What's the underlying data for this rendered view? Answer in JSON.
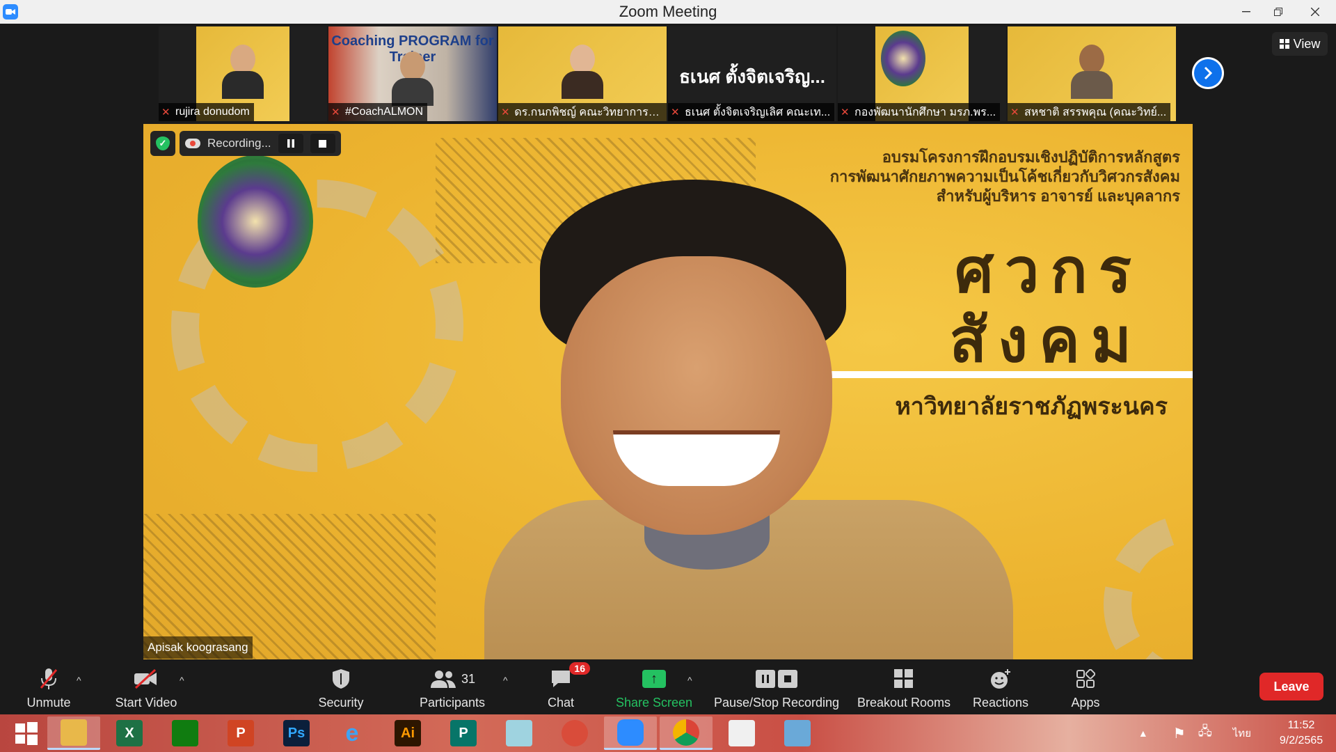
{
  "window": {
    "title": "Zoom Meeting"
  },
  "strip": {
    "tiles": [
      {
        "name": "rujira donudom",
        "muted": true
      },
      {
        "name": "#CoachALMON",
        "muted": true,
        "banner_text": "Coaching PROGRAM for Trainer"
      },
      {
        "name": "ดร.กนกพิชญ์ คณะวิทยาการจัด...",
        "muted": true
      },
      {
        "name": "ธเนศ ตั้งจิตเจริญเลิศ คณะเท...",
        "muted": true,
        "big_name": "ธเนศ ตั้งจิตเจริญ..."
      },
      {
        "name": "กองพัฒนานักศึกษา มรภ.พร...",
        "muted": true
      },
      {
        "name": "สหชาติ สรรพคุณ (คณะวิทย์...",
        "muted": true
      }
    ],
    "view_label": "View"
  },
  "main": {
    "speaker_name": "Apisak koograsang",
    "recording_label": "Recording...",
    "banner": {
      "line1": "อบรมโครงการฝึกอบรมเชิงปฏิบัติการหลักสูตร",
      "line2": "การพัฒนาศักยภาพความเป็นโค้ชเกี่ยวกับวิศวกรสังคม",
      "line3": "สำหรับผู้บริหาร อาจารย์ และบุคลากร",
      "big1": "ศวกร",
      "big2": "สังคม",
      "university": "หาวิทยาลัยราชภัฏพระนคร"
    }
  },
  "toolbar": {
    "unmute": "Unmute",
    "start_video": "Start Video",
    "security": "Security",
    "participants": "Participants",
    "participants_count": "31",
    "chat": "Chat",
    "chat_badge": "16",
    "share_screen": "Share Screen",
    "pause_stop_recording": "Pause/Stop Recording",
    "breakout_rooms": "Breakout Rooms",
    "reactions": "Reactions",
    "apps": "Apps",
    "leave": "Leave"
  },
  "taskbar": {
    "apps": [
      {
        "name": "Explorer",
        "label": ""
      },
      {
        "name": "Excel",
        "label": "X"
      },
      {
        "name": "Store",
        "label": ""
      },
      {
        "name": "PowerPoint",
        "label": "P"
      },
      {
        "name": "Photoshop",
        "label": "Ps"
      },
      {
        "name": "Internet Explorer",
        "label": "e"
      },
      {
        "name": "Illustrator",
        "label": "Ai"
      },
      {
        "name": "Publisher",
        "label": "P"
      },
      {
        "name": "Eraser",
        "label": ""
      },
      {
        "name": "PhotoScape",
        "label": ""
      },
      {
        "name": "Zoom",
        "label": ""
      },
      {
        "name": "Chrome",
        "label": ""
      },
      {
        "name": "Slides",
        "label": ""
      },
      {
        "name": "Remote",
        "label": ""
      }
    ],
    "lang": "ไทย",
    "time": "11:52",
    "date": "9/2/2565"
  },
  "colors": {
    "accent_blue": "#0e71eb",
    "leave_red": "#e02828",
    "share_green": "#24c161",
    "banner_yellow": "#f0be3c"
  }
}
